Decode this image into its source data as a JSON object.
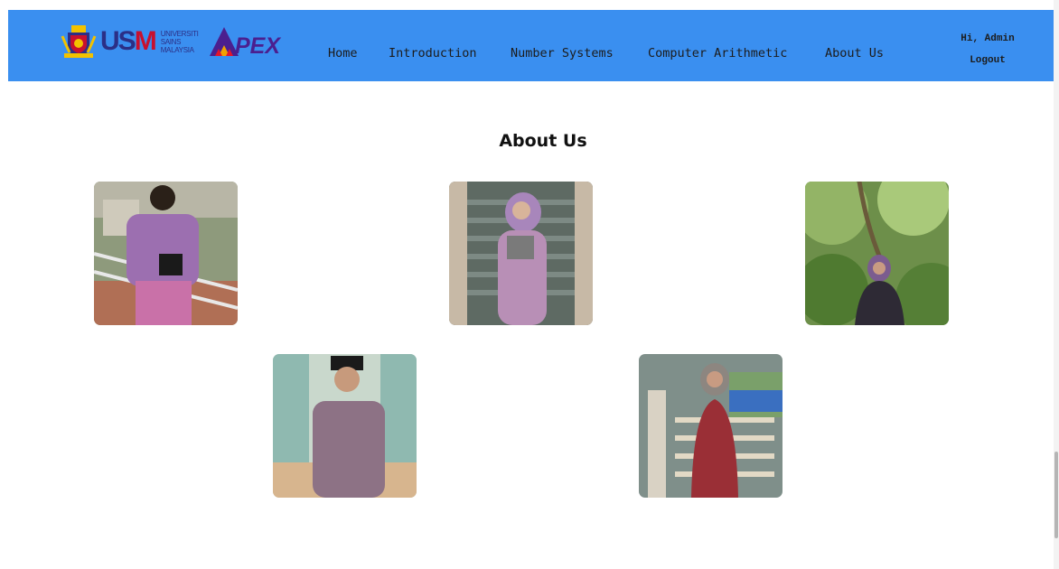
{
  "header": {
    "brand": {
      "usm_letters_us": "US",
      "usm_letters_m": "M",
      "university_lines": [
        "UNIVERSITI",
        "SAINS",
        "MALAYSIA"
      ],
      "apex_text": "PEX"
    },
    "nav": [
      {
        "label": "Home"
      },
      {
        "label": "Introduction"
      },
      {
        "label": "Number Systems"
      },
      {
        "label": "Computer Arithmetic"
      },
      {
        "label": "About Us"
      }
    ],
    "user": {
      "greeting": "Hi, Admin",
      "logout_label": "Logout"
    }
  },
  "main": {
    "title": "About Us",
    "photos": [
      {
        "icon": "team-member-photo"
      },
      {
        "icon": "team-member-photo"
      },
      {
        "icon": "team-member-photo"
      },
      {
        "icon": "team-member-photo"
      },
      {
        "icon": "team-member-photo"
      }
    ]
  },
  "colors": {
    "navbar": "#3a8ff0",
    "text": "#1c1c1c",
    "background": "#ffffff"
  }
}
